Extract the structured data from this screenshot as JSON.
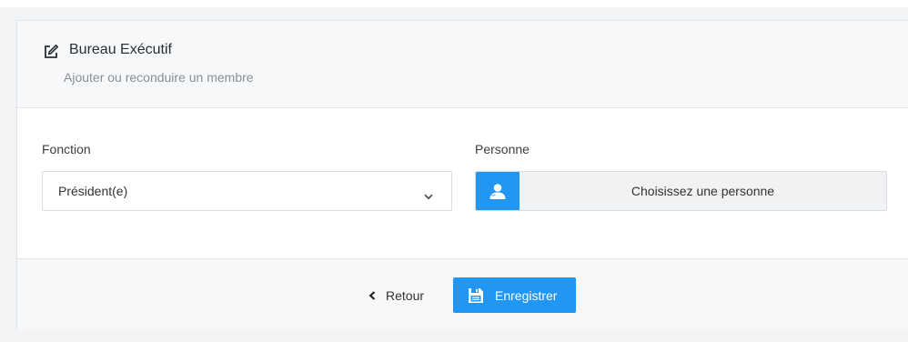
{
  "header": {
    "title": "Bureau Exécutif",
    "subtitle": "Ajouter ou reconduire un membre",
    "icon": "edit-icon"
  },
  "form": {
    "fonction": {
      "label": "Fonction",
      "selected": "Président(e)",
      "icon": "chevron-down-icon"
    },
    "personne": {
      "label": "Personne",
      "button_label": "Choisissez une personne",
      "icon": "user-icon"
    }
  },
  "footer": {
    "back_label": "Retour",
    "back_icon": "chevron-left-icon",
    "save_label": "Enregistrer",
    "save_icon": "floppy-disk-icon"
  },
  "colors": {
    "accent": "#2196f3",
    "background": "#f2f3f5",
    "header_bg": "#f7f8f9"
  }
}
